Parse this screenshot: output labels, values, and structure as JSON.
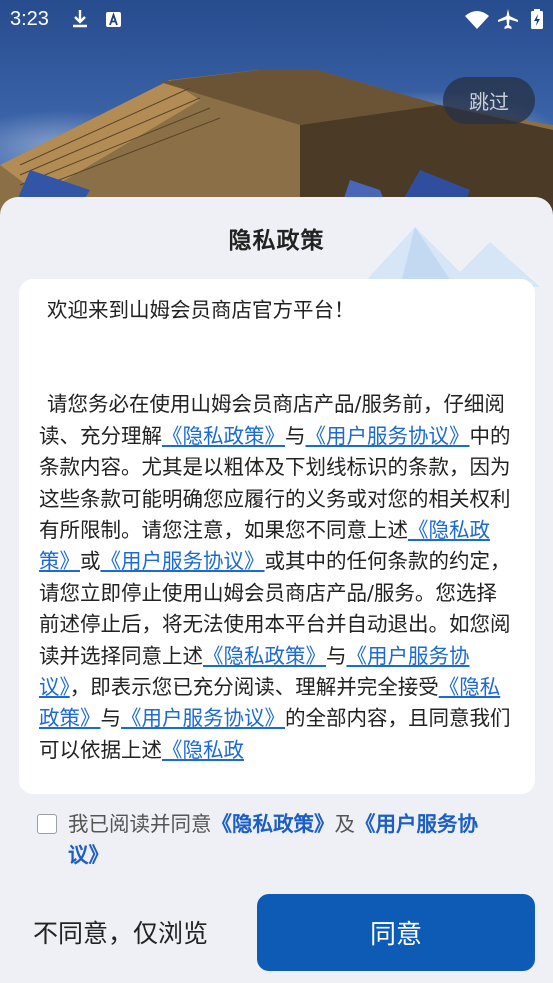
{
  "status_bar": {
    "time": "3:23",
    "icons": [
      "download-icon",
      "text-a-icon",
      "wifi-icon",
      "airplane-icon",
      "battery-icon"
    ]
  },
  "header": {
    "skip_label": "跳过"
  },
  "dialog": {
    "title": "隐私政策",
    "welcome": "欢迎来到山姆会员商店官方平台！",
    "body": {
      "t1": "请您务必在使用山姆会员商店产品/服务前，仔细阅读、充分理解",
      "l1": "《隐私政策》",
      "t2": "与",
      "l2": "《用户服务协议》",
      "t3": "中的条款内容。尤其是以粗体及下划线标识的条款，因为这些条款可能明确您应履行的义务或对您的相关权利有所限制。请您注意，如果您不同意上述",
      "l3": "《隐私政策》",
      "t4": "或",
      "l4": "《用户服务协议》",
      "t5": "或其中的任何条款的约定，请您立即停止使用山姆会员商店产品/服务。您选择前述停止后，将无法使用本平台并自动退出。如您阅读并选择同意上述",
      "l5": "《隐私政策》",
      "t6": "与",
      "l6": "《用户服务协议》",
      "t7": "，即表示您已充分阅读、理解并完全接受",
      "l7": "《隐私政策》",
      "t8": "与",
      "l8": "《用户服务协议》",
      "t9": "的全部内容，且同意我们可以依据上述",
      "l9": "《隐私政"
    },
    "consent": {
      "checked": false,
      "prefix": "我已阅读并同意",
      "privacy_link": "《隐私政策》",
      "and": "及",
      "terms_link": "《用户服务协议》"
    },
    "decline_label": "不同意，仅浏览",
    "agree_label": "同意"
  },
  "colors": {
    "link": "#1b6ad6",
    "primary_button": "#0d5bb5",
    "sheet_background": "#eef0f5"
  }
}
